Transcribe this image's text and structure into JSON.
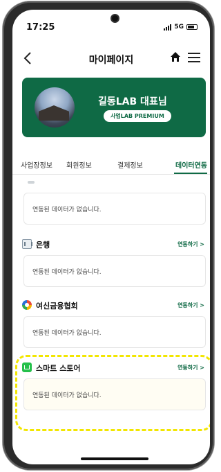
{
  "status": {
    "time": "17:25",
    "network": "5G"
  },
  "header": {
    "title": "마이페이지"
  },
  "profile": {
    "name": "길동LAB 대표님",
    "badge": "사업LAB PREMIUM"
  },
  "tabs": [
    {
      "label": "사업장정보"
    },
    {
      "label": "회원정보"
    },
    {
      "label": "결제정보"
    },
    {
      "label": "데이터연동",
      "active": true
    }
  ],
  "sections": {
    "top": {
      "message": "연동된 데이터가 없습니다."
    },
    "bank": {
      "title": "은행",
      "link": "연동하기 >",
      "message": "연동된 데이터가 없습니다."
    },
    "card": {
      "title": "여신금융협회",
      "link": "연동하기 >",
      "message": "연동된 데이터가 없습니다."
    },
    "store": {
      "title": "스마트 스토어",
      "link": "연동하기 >",
      "message": "연동된 데이터가 없습니다."
    }
  },
  "icons": {
    "back": "chevron-left-icon",
    "home": "home-icon",
    "menu": "hamburger-menu-icon",
    "bank": "bank-icon",
    "card": "card-association-icon",
    "store": "smart-store-icon"
  },
  "colors": {
    "accent": "#0f6a45",
    "highlight": "#f2e600"
  }
}
